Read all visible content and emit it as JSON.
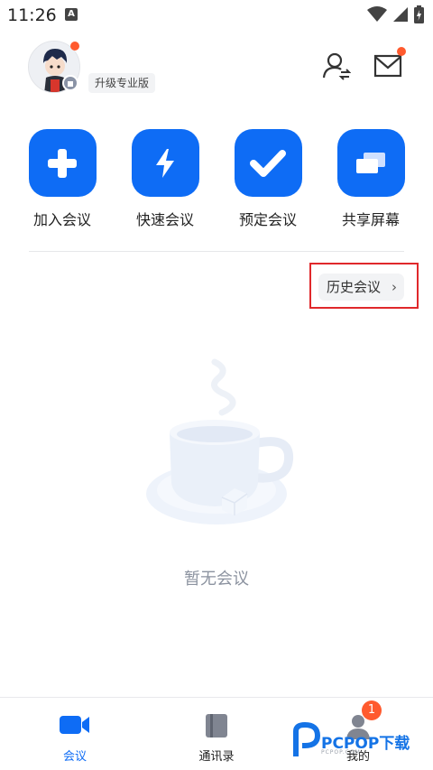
{
  "status_bar": {
    "time": "11:26",
    "a_icon": "A"
  },
  "header": {
    "upgrade_label": "升级专业版",
    "avatar_has_notification": true,
    "mail_has_notification": true,
    "icons": [
      "contacts-switch-icon",
      "mail-icon"
    ]
  },
  "actions": [
    {
      "label": "加入会议",
      "icon": "plus-icon"
    },
    {
      "label": "快速会议",
      "icon": "lightning-icon"
    },
    {
      "label": "预定会议",
      "icon": "check-icon"
    },
    {
      "label": "共享屏幕",
      "icon": "share-screen-icon"
    }
  ],
  "history_button": {
    "label": "历史会议",
    "chevron": "›"
  },
  "empty_state": {
    "text": "暂无会议",
    "illustration": "coffee-cup-illustration"
  },
  "bottom_nav": {
    "items": [
      {
        "label": "会议",
        "icon": "video-camera-icon",
        "active": true
      },
      {
        "label": "通讯录",
        "icon": "address-book-icon",
        "active": false
      },
      {
        "label": "我的",
        "icon": "person-icon",
        "active": false
      }
    ],
    "badge": "1"
  },
  "watermark": {
    "text": "PCPOP下载",
    "sub": "PCPOP.COM"
  },
  "colors": {
    "accent": "#0e6cf5",
    "notification": "#ff5a2e",
    "highlight_frame": "#e0282b"
  }
}
